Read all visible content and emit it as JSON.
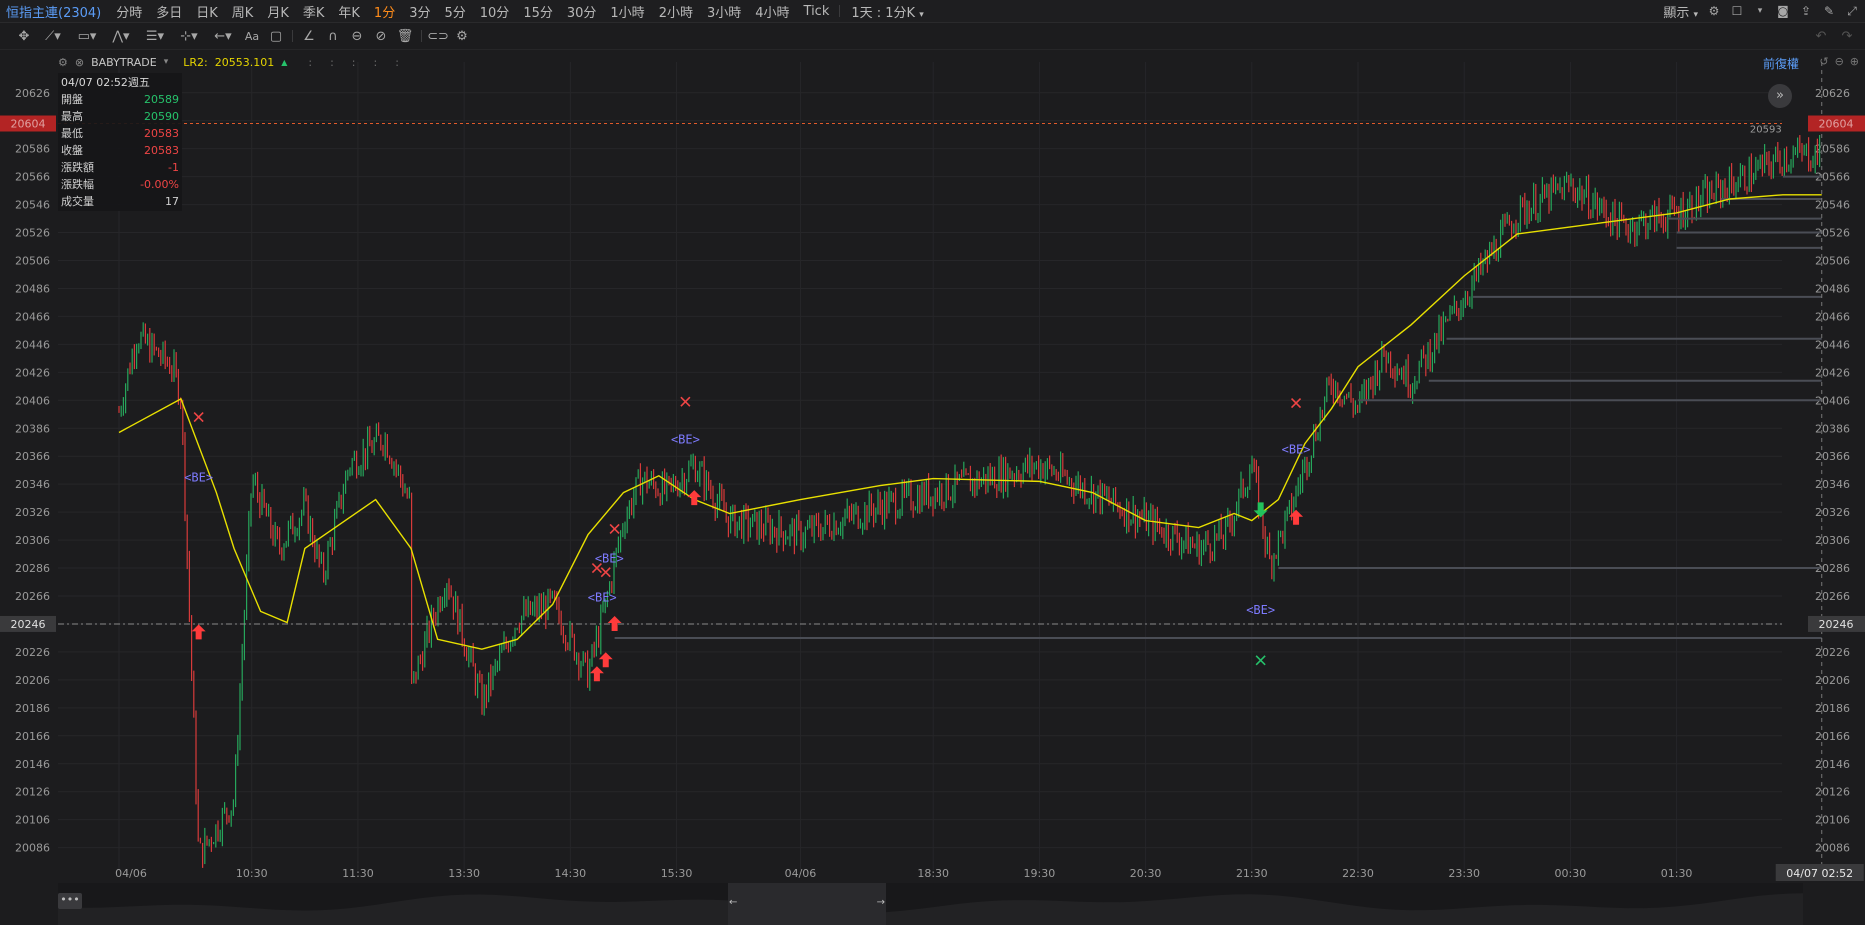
{
  "header": {
    "symbol": "恒指主連(2304)",
    "periods": [
      "分時",
      "多日",
      "日K",
      "周K",
      "月K",
      "季K",
      "年K",
      "1分",
      "3分",
      "5分",
      "10分",
      "15分",
      "30分",
      "1小時",
      "2小時",
      "3小時",
      "4小時",
      "Tick"
    ],
    "active_period": "1分",
    "range_select": "1天 : 1分K",
    "display_label": "顯示",
    "icons": [
      "gear-icon",
      "layout-icon",
      "camera-icon",
      "share-icon",
      "pen-icon",
      "fullscreen-icon"
    ]
  },
  "drawing_tools": [
    "crosshair-icon",
    "trendline-icon",
    "rectangle-icon",
    "pattern-icon",
    "fib-icon",
    "measure-icon",
    "arrow-icon",
    "text-icon",
    "comment-icon",
    "angle-icon",
    "magnet-icon",
    "lock-icon",
    "hide-icon",
    "delete-icon",
    "link-icon",
    "settings-icon",
    "undo-icon",
    "redo-icon"
  ],
  "indicator": {
    "name": "BABYTRADE",
    "lr2_label": "LR2:",
    "lr2_value": "20553.101",
    "adjust_label": "前復權"
  },
  "info_panel": {
    "date": "04/07 02:52週五",
    "rows": [
      {
        "key": "開盤",
        "value": "20589",
        "color": "green"
      },
      {
        "key": "最高",
        "value": "20590",
        "color": "green"
      },
      {
        "key": "最低",
        "value": "20583",
        "color": "red"
      },
      {
        "key": "收盤",
        "value": "20583",
        "color": "red"
      },
      {
        "key": "漲跌額",
        "value": "-1",
        "color": "red"
      },
      {
        "key": "漲跌幅",
        "value": "-0.00%",
        "color": "red"
      },
      {
        "key": "成交量",
        "value": "17",
        "color": "plain"
      }
    ]
  },
  "chart_data": {
    "type": "candlestick",
    "title": "",
    "y_ticks": [
      20626,
      20606,
      20586,
      20566,
      20546,
      20526,
      20506,
      20486,
      20466,
      20446,
      20426,
      20406,
      20386,
      20366,
      20346,
      20326,
      20306,
      20286,
      20266,
      20246,
      20226,
      20206,
      20186,
      20166,
      20146,
      20126,
      20106,
      20086
    ],
    "x_ticks": [
      "04/06",
      "10:30",
      "11:30",
      "13:30",
      "14:30",
      "15:30",
      "04/06",
      "18:30",
      "19:30",
      "20:30",
      "21:30",
      "22:30",
      "23:30",
      "00:30",
      "01:30"
    ],
    "ylim": [
      20070,
      20648
    ],
    "price_path_x": [
      "09:15",
      "09:25",
      "09:45",
      "09:50",
      "10:00",
      "10:20",
      "10:30",
      "10:45",
      "11:00",
      "11:10",
      "11:25",
      "11:45",
      "12:00",
      "13:00",
      "13:20",
      "13:40",
      "14:00",
      "14:20",
      "14:40",
      "14:50",
      "15:00",
      "15:10",
      "15:25",
      "15:40",
      "16:00",
      "17:15",
      "18:00",
      "18:30",
      "19:30",
      "20:00",
      "20:30",
      "21:00",
      "21:15",
      "21:30",
      "21:40",
      "21:50",
      "22:00",
      "22:15",
      "22:30",
      "22:45",
      "23:00",
      "23:30",
      "00:00",
      "00:30",
      "01:00",
      "01:30",
      "02:00",
      "02:30",
      "02:52"
    ],
    "price_path": [
      20398,
      20452,
      20430,
      20410,
      20080,
      20120,
      20350,
      20300,
      20330,
      20280,
      20360,
      20380,
      20330,
      20200,
      20280,
      20190,
      20250,
      20260,
      20210,
      20260,
      20320,
      20350,
      20340,
      20360,
      20320,
      20310,
      20330,
      20340,
      20360,
      20340,
      20320,
      20300,
      20310,
      20360,
      20290,
      20320,
      20360,
      20420,
      20400,
      20440,
      20420,
      20480,
      20540,
      20560,
      20530,
      20540,
      20560,
      20580,
      20583
    ],
    "lr_line_x": [
      "09:15",
      "09:50",
      "10:10",
      "10:20",
      "10:35",
      "10:50",
      "11:00",
      "11:40",
      "12:00",
      "13:15",
      "13:40",
      "14:00",
      "14:20",
      "14:40",
      "15:00",
      "15:20",
      "15:40",
      "16:00",
      "17:15",
      "18:00",
      "18:30",
      "19:30",
      "20:00",
      "20:30",
      "21:00",
      "21:20",
      "21:30",
      "21:45",
      "22:00",
      "22:15",
      "22:30",
      "23:00",
      "23:30",
      "00:00",
      "00:30",
      "01:00",
      "01:30",
      "02:00",
      "02:30",
      "02:52"
    ],
    "lr_line": [
      20383,
      20407,
      20340,
      20300,
      20255,
      20247,
      20300,
      20335,
      20300,
      20235,
      20228,
      20235,
      20260,
      20310,
      20340,
      20352,
      20335,
      20325,
      20335,
      20345,
      20350,
      20348,
      20340,
      20320,
      20315,
      20325,
      20320,
      20335,
      20375,
      20400,
      20430,
      20460,
      20495,
      20525,
      20530,
      20535,
      20540,
      20550,
      20553,
      20553
    ],
    "current_price": 20604,
    "current_price_label": "20604",
    "ref_price": 20246,
    "ref_price_label": "20246",
    "last_value_label": "20593",
    "cursor_time_label": "04/07 02:52",
    "be_labels": [
      {
        "text": "<BE>",
        "time": "10:00",
        "price": 20348
      },
      {
        "text": "<BE>",
        "time": "14:52",
        "price": 20290
      },
      {
        "text": "<BE>",
        "time": "14:48",
        "price": 20262
      },
      {
        "text": "<BE>",
        "time": "15:35",
        "price": 20375
      },
      {
        "text": "<BE>",
        "time": "21:35",
        "price": 20253
      },
      {
        "text": "<BE>",
        "time": "21:55",
        "price": 20368
      }
    ],
    "x_marks": [
      {
        "time": "10:00",
        "price": 20394,
        "color": "red"
      },
      {
        "time": "14:45",
        "price": 20286,
        "color": "red"
      },
      {
        "time": "14:50",
        "price": 20283,
        "color": "red"
      },
      {
        "time": "14:55",
        "price": 20314,
        "color": "red"
      },
      {
        "time": "15:35",
        "price": 20405,
        "color": "red"
      },
      {
        "time": "21:55",
        "price": 20404,
        "color": "red"
      },
      {
        "time": "21:35",
        "price": 20220,
        "color": "green"
      }
    ],
    "buy_arrows": [
      {
        "time": "10:00",
        "price": 20240
      },
      {
        "time": "14:45",
        "price": 20210
      },
      {
        "time": "14:50",
        "price": 20220
      },
      {
        "time": "14:55",
        "price": 20246
      },
      {
        "time": "15:40",
        "price": 20336
      },
      {
        "time": "21:55",
        "price": 20322
      }
    ],
    "sell_arrows": [
      {
        "time": "21:35",
        "price": 20328
      }
    ],
    "levels": [
      {
        "price": 20236,
        "from": "14:55",
        "to": "02:52"
      },
      {
        "price": 20286,
        "from": "21:45",
        "to": "02:52"
      },
      {
        "price": 20406,
        "from": "22:30",
        "to": "02:52"
      },
      {
        "price": 20420,
        "from": "23:10",
        "to": "02:52"
      },
      {
        "price": 20450,
        "from": "23:20",
        "to": "02:52"
      },
      {
        "price": 20480,
        "from": "23:35",
        "to": "02:52"
      },
      {
        "price": 20515,
        "from": "01:30",
        "to": "02:52"
      },
      {
        "price": 20526,
        "from": "01:30",
        "to": "02:52"
      },
      {
        "price": 20536,
        "from": "01:25",
        "to": "02:52"
      },
      {
        "price": 20550,
        "from": "01:55",
        "to": "02:52"
      },
      {
        "price": 20566,
        "from": "02:30",
        "to": "02:52"
      }
    ]
  }
}
